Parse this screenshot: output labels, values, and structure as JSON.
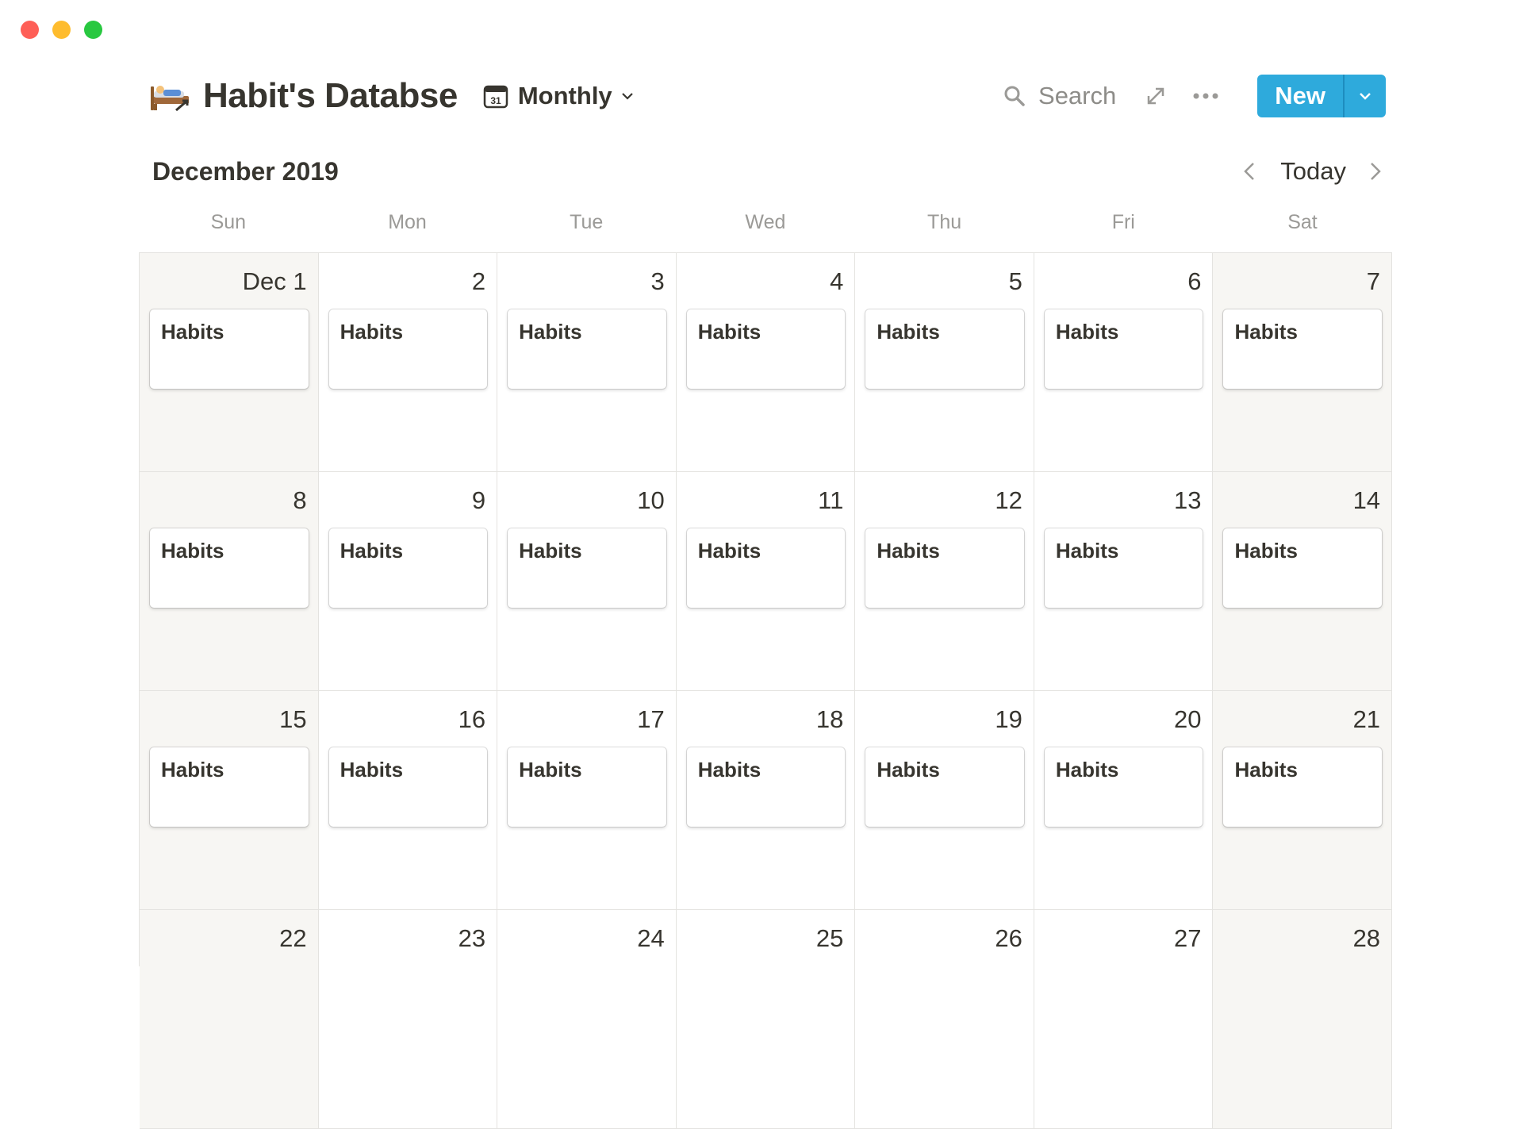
{
  "window": {
    "controls": [
      "close",
      "minimize",
      "zoom"
    ]
  },
  "header": {
    "title_icon": "bed-person-emoji-icon",
    "title": "Habit's Databse",
    "view_icon": "calendar-icon",
    "view_label": "Monthly",
    "search_label": "Search",
    "new_label": "New"
  },
  "calendar": {
    "month_label": "December 2019",
    "today_label": "Today",
    "weekdays": [
      "Sun",
      "Mon",
      "Tue",
      "Wed",
      "Thu",
      "Fri",
      "Sat"
    ],
    "weeks": [
      [
        {
          "day": "Dec 1",
          "entries": [
            "Habits"
          ]
        },
        {
          "day": "2",
          "entries": [
            "Habits"
          ]
        },
        {
          "day": "3",
          "entries": [
            "Habits"
          ]
        },
        {
          "day": "4",
          "entries": [
            "Habits"
          ]
        },
        {
          "day": "5",
          "entries": [
            "Habits"
          ]
        },
        {
          "day": "6",
          "entries": [
            "Habits"
          ]
        },
        {
          "day": "7",
          "entries": [
            "Habits"
          ]
        }
      ],
      [
        {
          "day": "8",
          "entries": [
            "Habits"
          ]
        },
        {
          "day": "9",
          "entries": [
            "Habits"
          ]
        },
        {
          "day": "10",
          "entries": [
            "Habits"
          ]
        },
        {
          "day": "11",
          "entries": [
            "Habits"
          ]
        },
        {
          "day": "12",
          "entries": [
            "Habits"
          ]
        },
        {
          "day": "13",
          "entries": [
            "Habits"
          ]
        },
        {
          "day": "14",
          "entries": [
            "Habits"
          ]
        }
      ],
      [
        {
          "day": "15",
          "entries": [
            "Habits"
          ]
        },
        {
          "day": "16",
          "entries": [
            "Habits"
          ]
        },
        {
          "day": "17",
          "entries": [
            "Habits"
          ]
        },
        {
          "day": "18",
          "entries": [
            "Habits"
          ]
        },
        {
          "day": "19",
          "entries": [
            "Habits"
          ]
        },
        {
          "day": "20",
          "entries": [
            "Habits"
          ]
        },
        {
          "day": "21",
          "entries": [
            "Habits"
          ]
        }
      ],
      [
        {
          "day": "22",
          "entries": []
        },
        {
          "day": "23",
          "entries": []
        },
        {
          "day": "24",
          "entries": []
        },
        {
          "day": "25",
          "entries": []
        },
        {
          "day": "26",
          "entries": []
        },
        {
          "day": "27",
          "entries": []
        },
        {
          "day": "28",
          "entries": []
        }
      ]
    ]
  },
  "colors": {
    "accent": "#2eaadc",
    "weekend_bg": "#f7f6f3",
    "grid_line": "#e4e3e0",
    "text": "#37352f",
    "muted": "#9b9a97"
  }
}
